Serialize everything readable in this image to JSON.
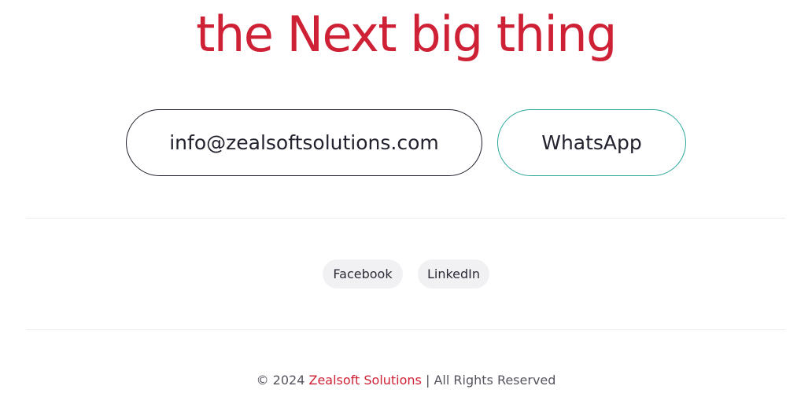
{
  "hero": {
    "headline": "the Next big thing"
  },
  "contact": {
    "email_label": "info@zealsoftsolutions.com",
    "whatsapp_label": "WhatsApp"
  },
  "social": {
    "items": [
      {
        "label": "Facebook"
      },
      {
        "label": "LinkedIn"
      }
    ]
  },
  "footer": {
    "copyright_prefix": "© 2024",
    "brand": "Zealsoft Solutions",
    "rights": "| All Rights Reserved"
  },
  "colors": {
    "accent": "#cf2136",
    "whatsapp_border": "#2aa79b",
    "chip_background": "#f1f1f3"
  }
}
